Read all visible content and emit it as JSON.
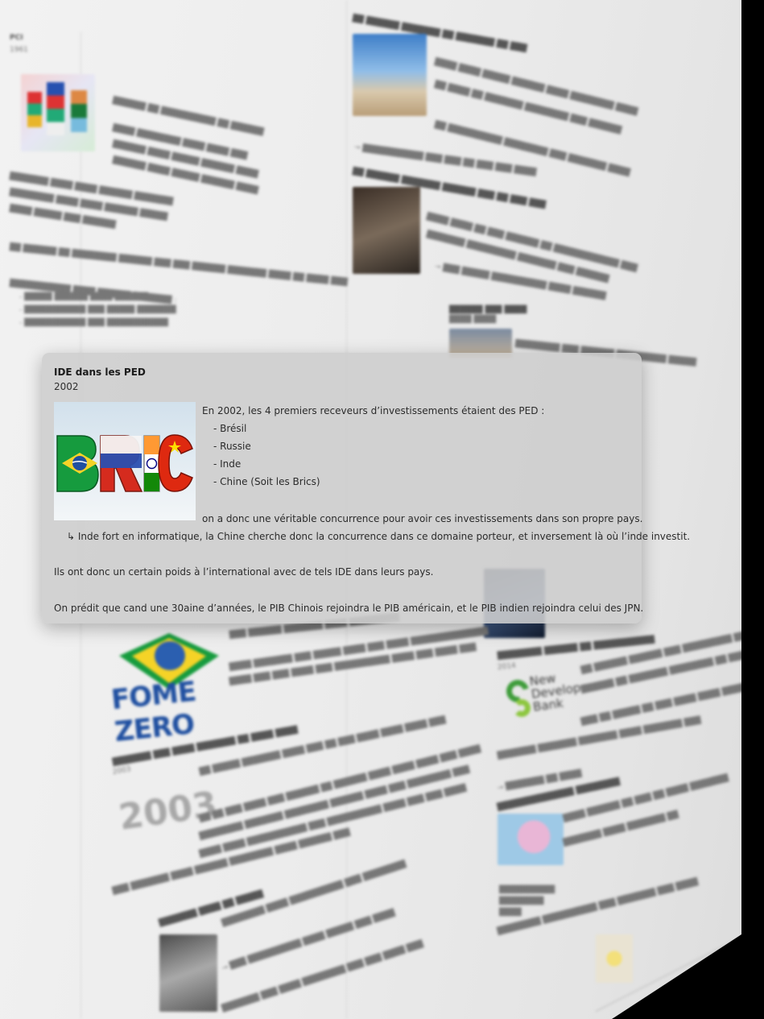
{
  "card": {
    "title": "IDE dans les PED",
    "date": "2002",
    "image_label": "BRIC",
    "intro": "En 2002, les 4 premiers receveurs d’investissements étaient des PED :",
    "countries": [
      "- Brésil",
      "- Russie",
      "- Inde",
      "- Chine (Soit les Brics)"
    ],
    "line_concurrence": "on a donc une véritable concurrence pour avoir ces investissements dans son propre pays.",
    "line_inde": "↳ Inde fort en informatique, la Chine cherche donc la concurrence dans ce domaine porteur, et inversement là où l’inde investit.",
    "line_poids": "Ils ont donc un certain poids à l’international avec de tels IDE dans leurs pays.",
    "line_prediction": "On prédit que cand une 30aine d’années, le PIB Chinois rejoindra le PIB américain, et le PIB indien rejoindra celui des JPN."
  },
  "background": {
    "fome_zero_label": "FOME ZERO",
    "year_2003_label": "2003",
    "ndb_label": "New Development Bank"
  },
  "colors": {
    "card_bg": "#cdcdcd",
    "brazil_green": "#169b3e",
    "brazil_yellow": "#f5d327",
    "russia_red": "#d52b1e",
    "fome_blue": "#1f4fa0",
    "ndb_green": "#3e9c3a"
  }
}
